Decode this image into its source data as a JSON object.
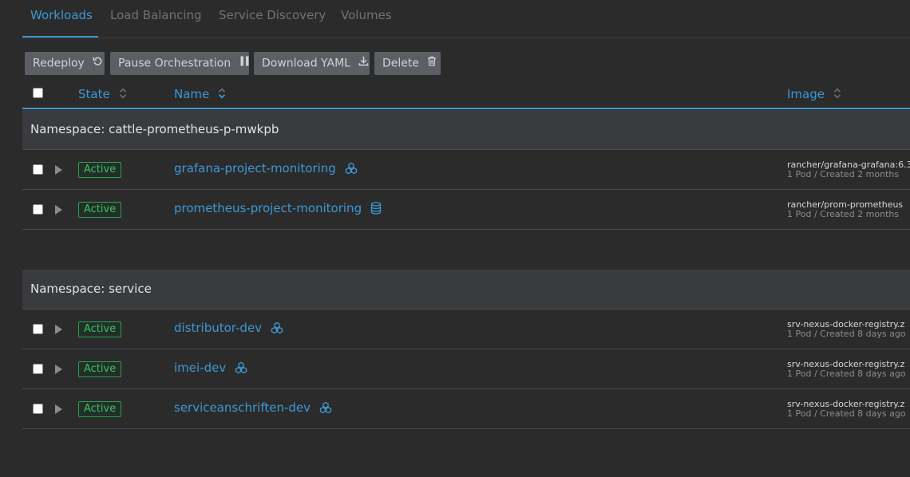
{
  "tabs": [
    {
      "label": "Workloads",
      "active": true
    },
    {
      "label": "Load Balancing",
      "active": false
    },
    {
      "label": "Service Discovery",
      "active": false
    },
    {
      "label": "Volumes",
      "active": false
    }
  ],
  "toolbar": {
    "redeploy": "Redeploy",
    "pause": "Pause Orchestration",
    "download": "Download YAML",
    "delete": "Delete"
  },
  "table": {
    "headers": {
      "state": "State",
      "name": "Name",
      "image": "Image"
    }
  },
  "groups": [
    {
      "namespace": "Namespace: cattle-prometheus-p-mwkpb",
      "rows": [
        {
          "state": "Active",
          "name": "grafana-project-monitoring",
          "icon": "cluster-icon",
          "image": "rancher/grafana-grafana:6.3",
          "meta": "1 Pod / Created 2 months"
        },
        {
          "state": "Active",
          "name": "prometheus-project-monitoring",
          "icon": "database-icon",
          "image": "rancher/prom-prometheus",
          "meta": "1 Pod / Created 2 months"
        }
      ]
    },
    {
      "namespace": "Namespace: service",
      "rows": [
        {
          "state": "Active",
          "name": "distributor-dev",
          "icon": "cluster-icon",
          "image": "srv-nexus-docker-registry.z",
          "meta": "1 Pod / Created 8 days ago"
        },
        {
          "state": "Active",
          "name": "imei-dev",
          "icon": "cluster-icon",
          "image": "srv-nexus-docker-registry.z",
          "meta": "1 Pod / Created 8 days ago"
        },
        {
          "state": "Active",
          "name": "serviceanschriften-dev",
          "icon": "cluster-icon",
          "image": "srv-nexus-docker-registry.z",
          "meta": "1 Pod / Created 8 days ago"
        }
      ]
    }
  ],
  "colors": {
    "accent": "#3d98d3",
    "active": "#3fbf64",
    "background": "#2b2b2c"
  }
}
